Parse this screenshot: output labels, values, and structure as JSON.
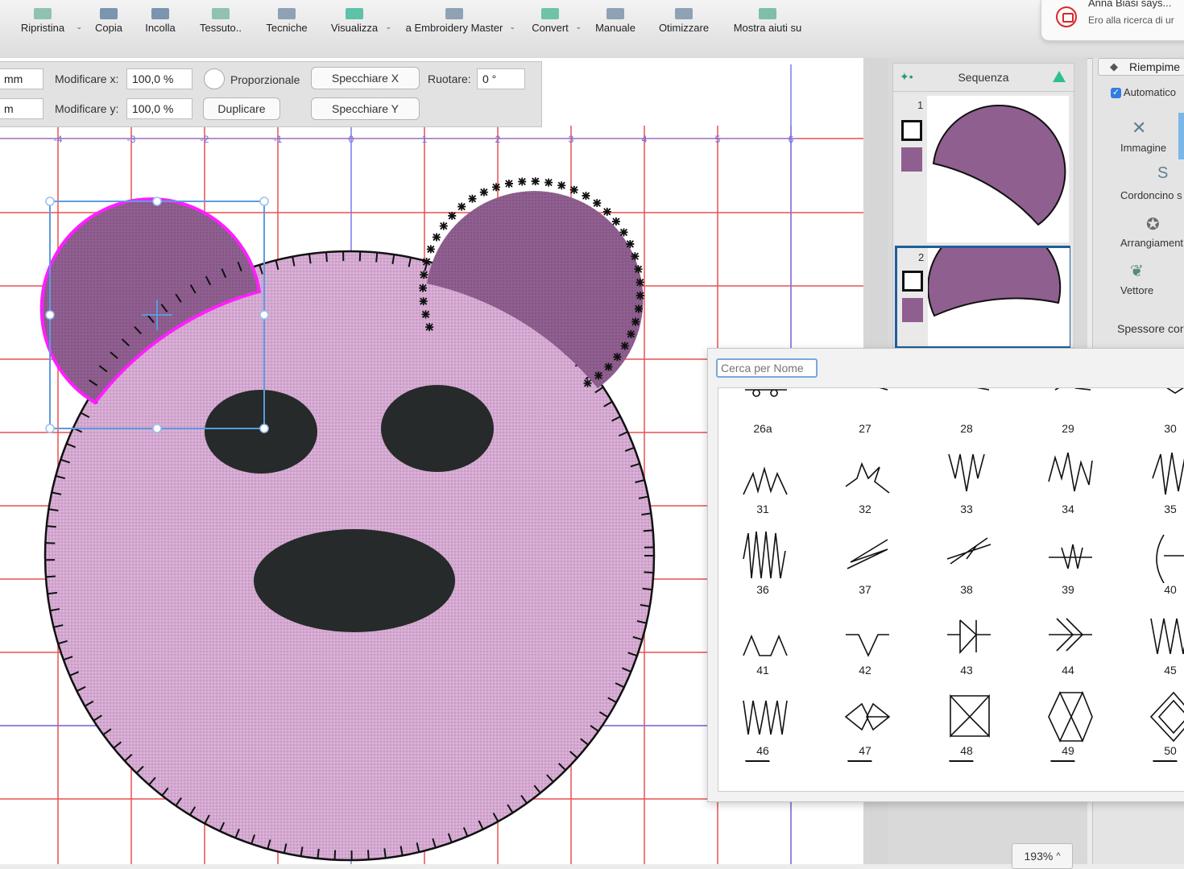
{
  "toolbar": {
    "items": [
      {
        "label": "Ripristina",
        "has_dropdown": true
      },
      {
        "label": "Copia"
      },
      {
        "label": "Incolla"
      },
      {
        "label": "Tessuto.."
      },
      {
        "label": "Tecniche"
      },
      {
        "label": "Visualizza",
        "has_dropdown": true
      },
      {
        "label": "a Embroidery Master",
        "has_dropdown": true
      },
      {
        "label": "Convert",
        "has_dropdown": true
      },
      {
        "label": "Manuale"
      },
      {
        "label": "Otimizzare"
      },
      {
        "label": "Mostra aiuti su"
      }
    ],
    "dropdown_glyph": "⌄"
  },
  "notification": {
    "sender": "Anna Biasi says...",
    "message": "Ero alla ricerca di ur"
  },
  "properties": {
    "field_x_value": "mm",
    "field_y_value": "m",
    "modify_x_label": "Modificare x:",
    "modify_x_value": "100,0 %",
    "modify_y_label": "Modificare y:",
    "modify_y_value": "100,0 %",
    "proportional_label": "Proporzionale",
    "duplicate_label": "Duplicare",
    "mirror_x_label": "Specchiare X",
    "mirror_y_label": "Specchiare Y",
    "rotate_label": "Ruotare:",
    "rotate_value": "0 °"
  },
  "ruler": {
    "ticks": [
      "-4",
      "-3",
      "-2",
      "-1",
      "0",
      "1",
      "2",
      "3",
      "4",
      "5",
      "6"
    ]
  },
  "sequence": {
    "title": "Sequenza",
    "items": [
      {
        "number": "1",
        "selected": false
      },
      {
        "number": "2",
        "selected": true
      }
    ]
  },
  "right_panel": {
    "fill_label": "Riempime",
    "automatic_label": "Automatico",
    "automatic_checked": true,
    "tools": [
      {
        "label": "Immagine",
        "icon": "needle-icon"
      },
      {
        "label": "Cordoncino s",
        "icon": "cord-icon"
      },
      {
        "label": "Arrangiament",
        "icon": "arrange-icon"
      },
      {
        "label": "Vettore",
        "icon": "leaf-icon"
      }
    ],
    "thickness_label": "Spessore cor"
  },
  "picker": {
    "search_placeholder": "Cerca per Nome",
    "patterns": [
      "26a",
      "27",
      "28",
      "29",
      "30",
      "31",
      "32",
      "33",
      "34",
      "35",
      "36",
      "37",
      "38",
      "39",
      "40",
      "41",
      "42",
      "43",
      "44",
      "45",
      "46",
      "47",
      "48",
      "49",
      "50"
    ]
  },
  "zoom": {
    "label": "193%",
    "caret": "^"
  },
  "colors": {
    "fabric": "#d4a9d1",
    "ear": "#8f5f8f",
    "selection": "#ff1eff",
    "grid_red": "#e85050",
    "grid_blue": "#7a7aee"
  }
}
